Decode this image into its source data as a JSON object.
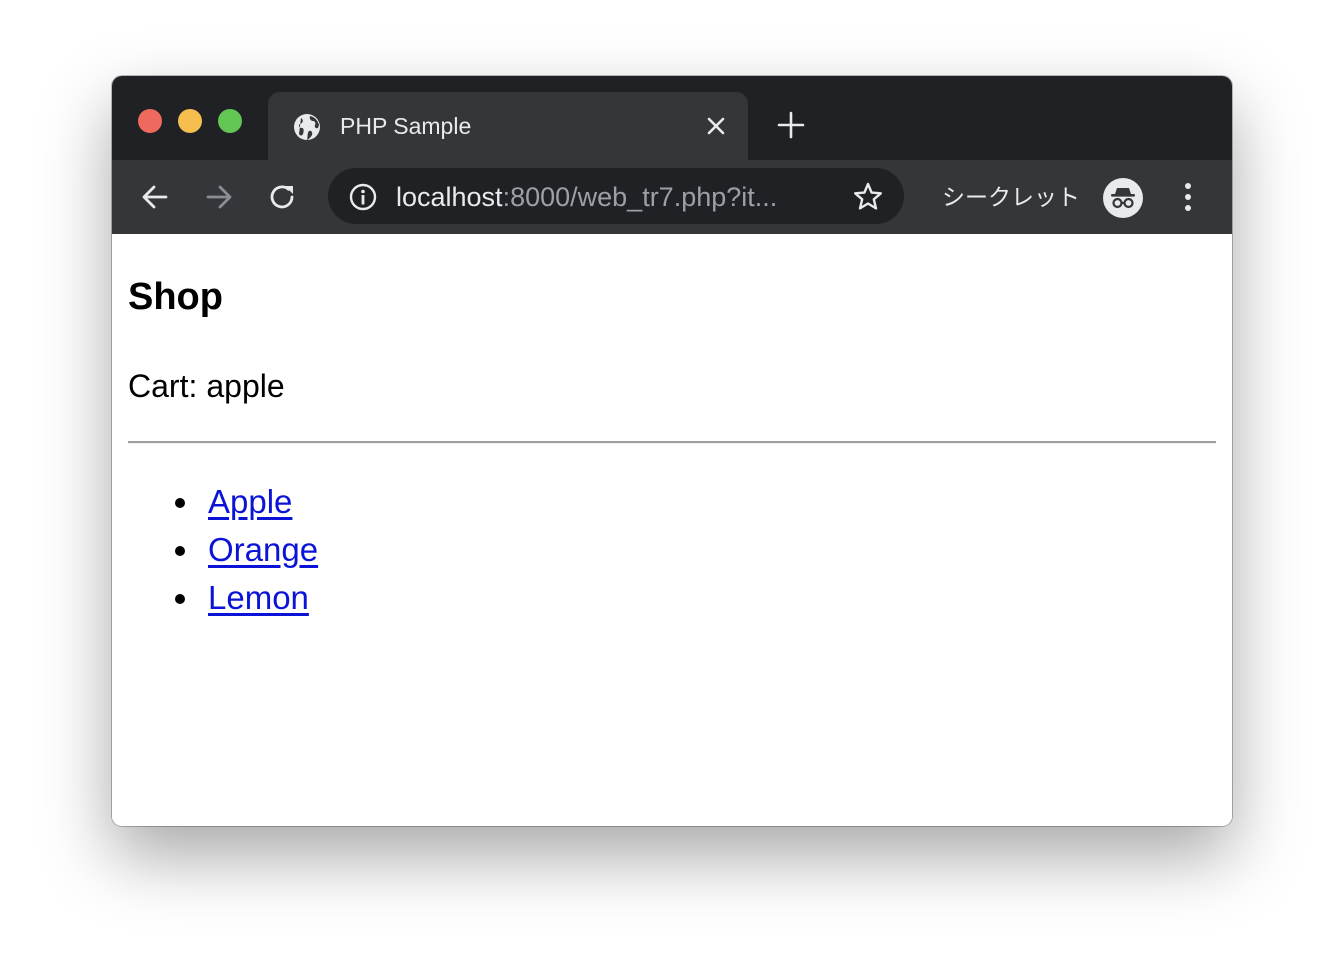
{
  "browser": {
    "tab": {
      "title": "PHP Sample",
      "favicon": "globe-icon",
      "close_icon": "close-icon"
    },
    "new_tab_icon": "plus-icon",
    "nav": {
      "back_icon": "back-arrow-icon",
      "forward_icon": "forward-arrow-icon",
      "reload_icon": "reload-icon"
    },
    "address_bar": {
      "security_icon": "info-icon",
      "url_host": "localhost",
      "url_rest": ":8000/web_tr7.php?it...",
      "bookmark_icon": "star-icon"
    },
    "profile": {
      "label": "シークレット",
      "icon": "incognito-icon"
    },
    "menu_icon": "more-vert-icon",
    "colors": {
      "tabstrip_bg": "#202124",
      "toolbar_bg": "#35363a",
      "close": "#ee6a5f",
      "minimize": "#f5be4f",
      "zoom": "#62c655"
    }
  },
  "page": {
    "heading": "Shop",
    "cart_label": "Cart:",
    "cart_value": "apple",
    "items": [
      {
        "label": "Apple"
      },
      {
        "label": "Orange"
      },
      {
        "label": "Lemon"
      }
    ],
    "link_color": "#0b14d6"
  }
}
